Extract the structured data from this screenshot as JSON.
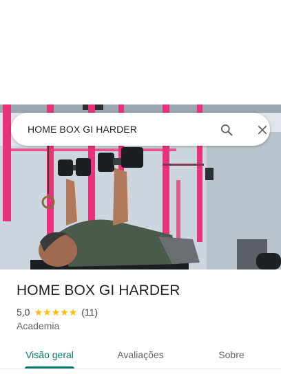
{
  "search": {
    "query": "HOME BOX GI HARDER"
  },
  "place": {
    "title": "HOME BOX GI HARDER",
    "rating": "5,0",
    "stars": "★★★★★",
    "review_count": "(11)",
    "category": "Academia"
  },
  "tabs": [
    {
      "label": "Visão geral",
      "active": true
    },
    {
      "label": "Avaliações",
      "active": false
    },
    {
      "label": "Sobre",
      "active": false
    }
  ],
  "colors": {
    "accent": "#00796b",
    "star": "#fbbc04",
    "pink_rack": "#e8337a"
  },
  "icons": {
    "search": "search-icon",
    "close": "close-icon"
  }
}
